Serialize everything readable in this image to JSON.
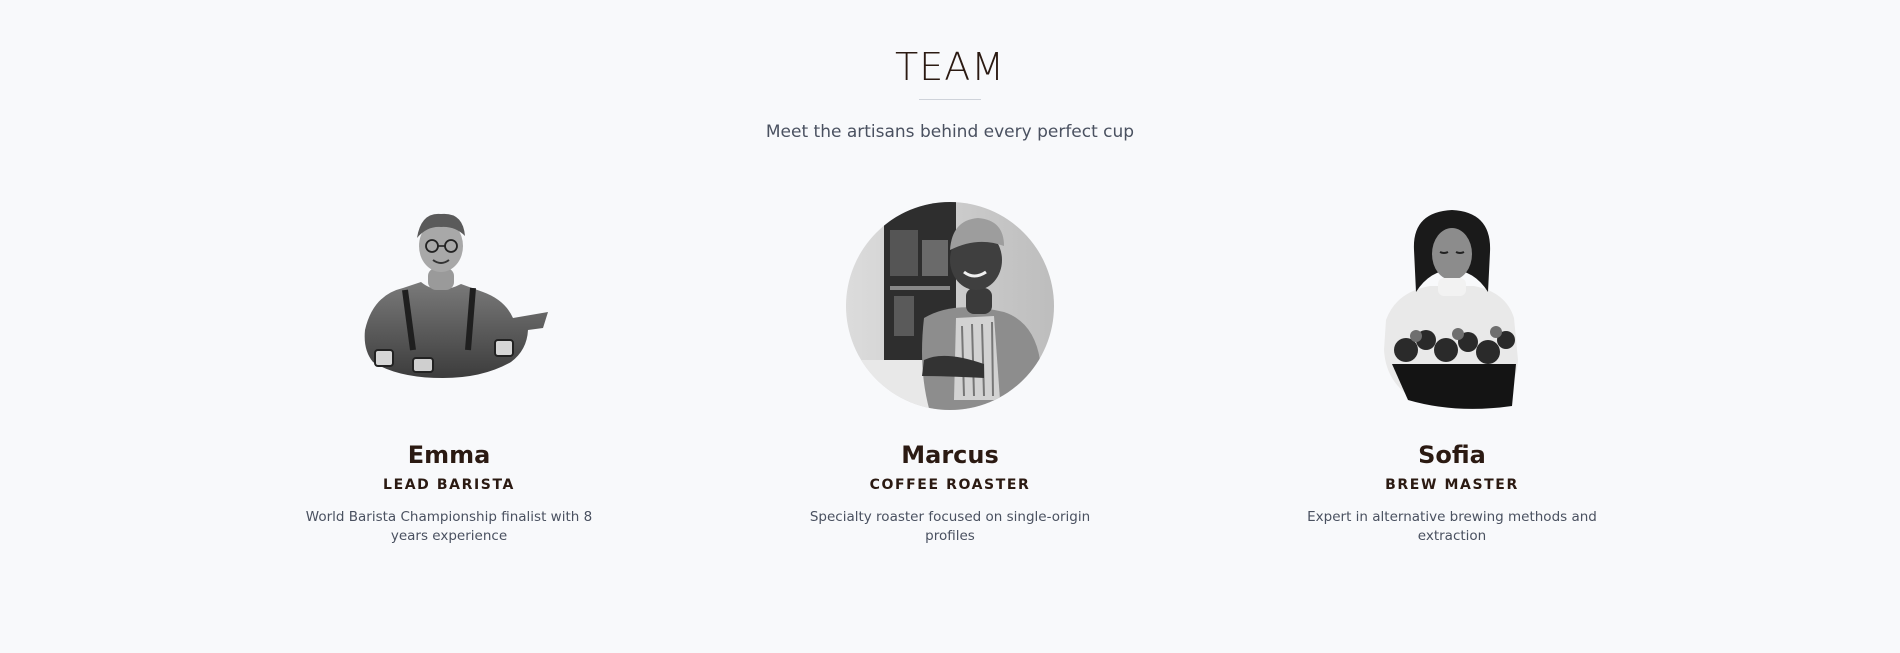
{
  "section": {
    "title": "TEAM",
    "subtitle": "Meet the artisans behind every perfect cup"
  },
  "members": [
    {
      "name": "Emma",
      "role": "LEAD BARISTA",
      "bio": "World Barista Championship finalist with 8 years experience",
      "photo": "emma-portrait"
    },
    {
      "name": "Marcus",
      "role": "COFFEE ROASTER",
      "bio": "Specialty roaster focused on single-origin profiles",
      "photo": "marcus-portrait"
    },
    {
      "name": "Sofia",
      "role": "BREW MASTER",
      "bio": "Expert in alternative brewing methods and extraction",
      "photo": "sofia-portrait"
    }
  ]
}
